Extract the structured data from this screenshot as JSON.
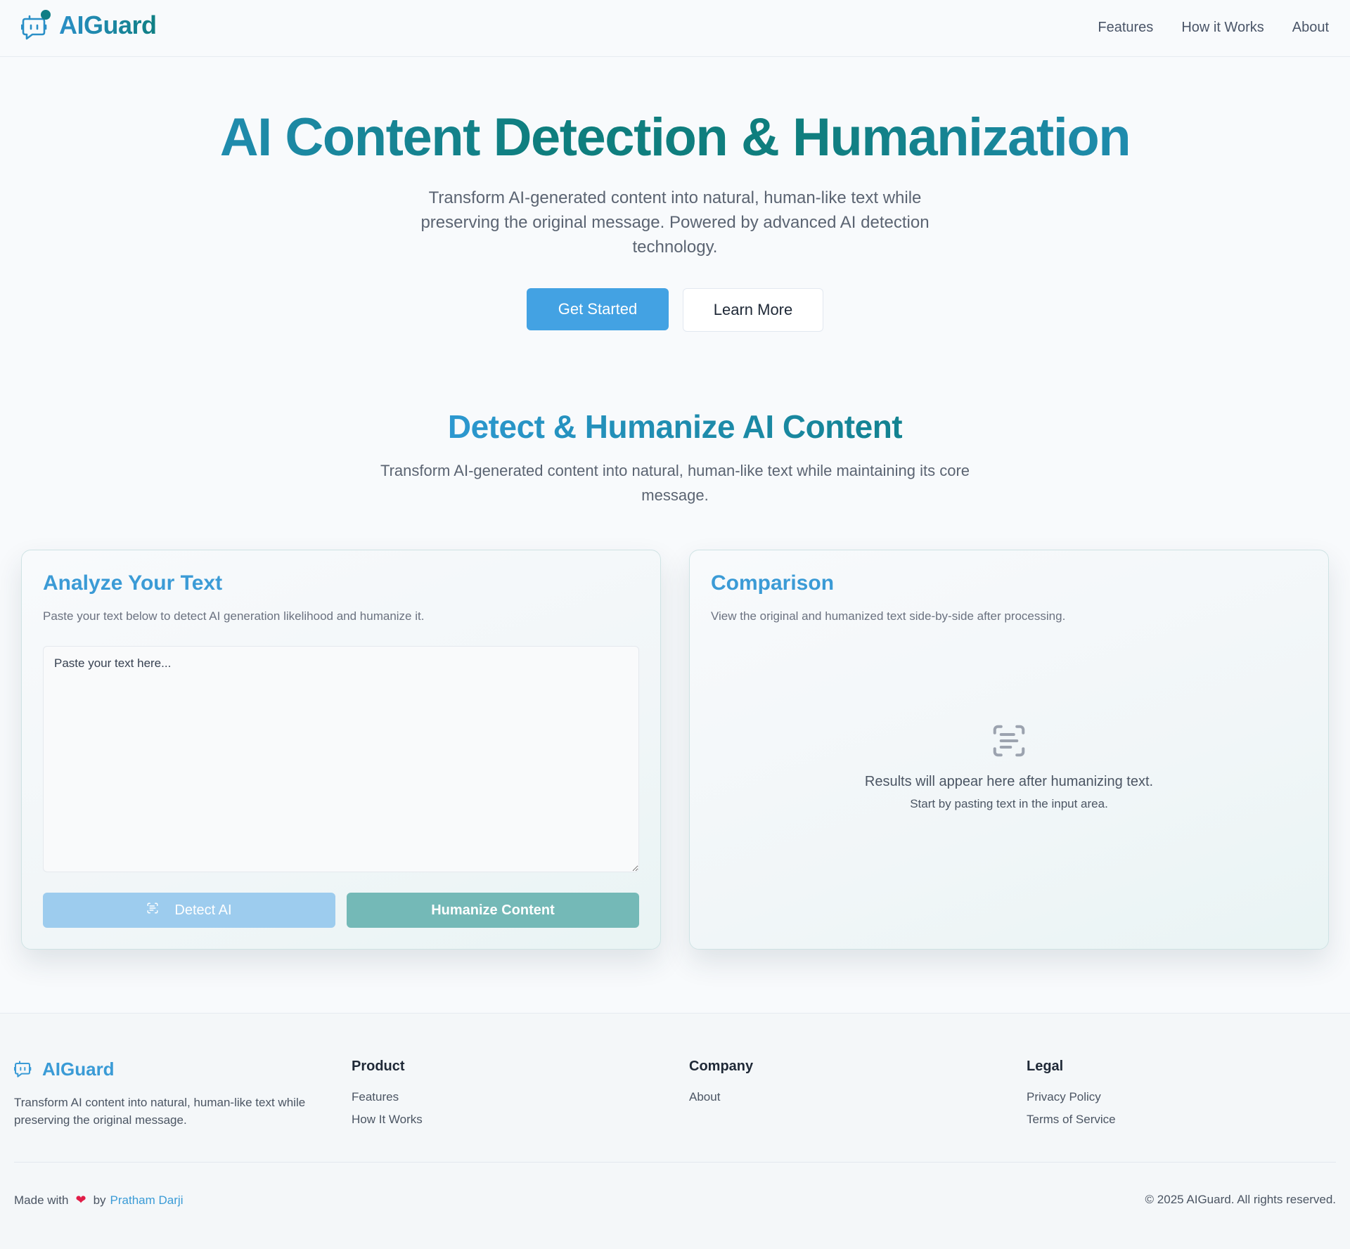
{
  "nav": {
    "brand": "AIGuard",
    "links": [
      "Features",
      "How it Works",
      "About"
    ]
  },
  "hero": {
    "title": "AI Content Detection & Humanization",
    "subtitle": "Transform AI-generated content into natural, human-like text while preserving the original message. Powered by advanced AI detection technology.",
    "primary_button": "Get Started",
    "secondary_button": "Learn More"
  },
  "section": {
    "title": "Detect & Humanize AI Content",
    "subtitle": "Transform AI-generated content into natural, human-like text while maintaining its core message."
  },
  "analyze_card": {
    "title": "Analyze Your Text",
    "description": "Paste your text below to detect AI generation likelihood and humanize it.",
    "input_placeholder": "Paste your text here...",
    "input_value": "",
    "detect_button": "Detect AI",
    "humanize_button": "Humanize Content"
  },
  "comparison_card": {
    "title": "Comparison",
    "description": "View the original and humanized text side-by-side after processing.",
    "empty_main": "Results will appear here after humanizing text.",
    "empty_sub": "Start by pasting text in the input area."
  },
  "footer": {
    "brand": "AIGuard",
    "description": "Transform AI content into natural, human-like text while preserving the original message.",
    "columns": [
      {
        "heading": "Product",
        "links": [
          "Features",
          "How It Works"
        ]
      },
      {
        "heading": "Company",
        "links": [
          "About"
        ]
      },
      {
        "heading": "Legal",
        "links": [
          "Privacy Policy",
          "Terms of Service"
        ]
      }
    ],
    "made_with_prefix": "Made with",
    "made_with_by": "by",
    "author": "Pratham Darji",
    "copyright": "© 2025 AIGuard. All rights reserved."
  },
  "icons": {
    "brand": "bot-icon",
    "detect": "scan-text-icon",
    "empty_state": "scan-text-icon",
    "heart": "heart-icon"
  },
  "colors": {
    "primary_blue": "#43a2e3",
    "teal": "#0f7e7e",
    "detect_button": "#9dccee",
    "humanize_button": "#74b9b7",
    "heart": "#e11d48"
  }
}
